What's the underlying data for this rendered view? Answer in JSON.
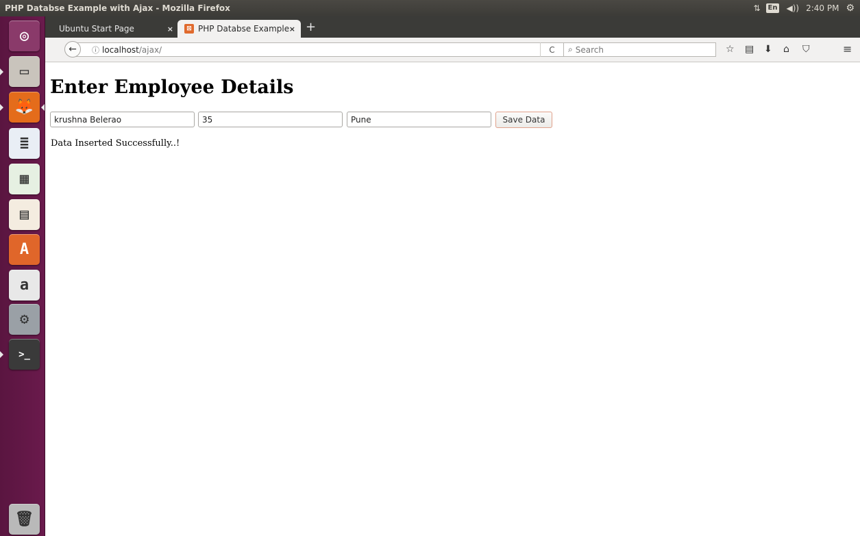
{
  "panel": {
    "window_title": "PHP Databse Example with Ajax - Mozilla Firefox",
    "network_indicator": "⇅",
    "keyboard_layout": "En",
    "volume": "◀))",
    "clock": "2:40 PM",
    "session": "⚙"
  },
  "launcher": {
    "items": [
      {
        "name": "dash-home",
        "glyph": "◎",
        "color": "#8a3a6a"
      },
      {
        "name": "files",
        "glyph": "▭",
        "color": "#c9c4bc"
      },
      {
        "name": "firefox",
        "glyph": "🦊",
        "color": "#e46c1b"
      },
      {
        "name": "libreoffice-writer",
        "glyph": "≣",
        "color": "#e9eef5"
      },
      {
        "name": "libreoffice-calc",
        "glyph": "▦",
        "color": "#e6f0e2"
      },
      {
        "name": "libreoffice-impress",
        "glyph": "▤",
        "color": "#f4ece0"
      },
      {
        "name": "software-center",
        "glyph": "A",
        "color": "#e0662a"
      },
      {
        "name": "amazon",
        "glyph": "a",
        "color": "#e8e8e8"
      },
      {
        "name": "system-settings",
        "glyph": "⚙",
        "color": "#9aa0a6"
      },
      {
        "name": "terminal",
        "glyph": ">_",
        "color": "#3a3a3a"
      },
      {
        "name": "trash",
        "glyph": "🗑",
        "color": "#b9b9b9"
      }
    ]
  },
  "browser": {
    "tabs": [
      {
        "label": "Ubuntu Start Page"
      },
      {
        "label": "PHP Databse Example"
      }
    ],
    "tab_close": "×",
    "new_tab": "+",
    "back": "←",
    "url_host": "localhost",
    "url_path": "/ajax/",
    "info_icon": "ⓘ",
    "reload": "C",
    "search_placeholder": "Search",
    "search_glyph": "🔍",
    "toolbar_icons": [
      "☆",
      "▤",
      "⬇",
      "⌂",
      "⛉"
    ],
    "menu": "≡"
  },
  "page": {
    "title": "Enter Employee Details",
    "fields": {
      "name": "krushna Belerao",
      "age": "35",
      "city": "Pune"
    },
    "save_label": "Save Data",
    "result_message": "Data Inserted Successfully..!"
  }
}
